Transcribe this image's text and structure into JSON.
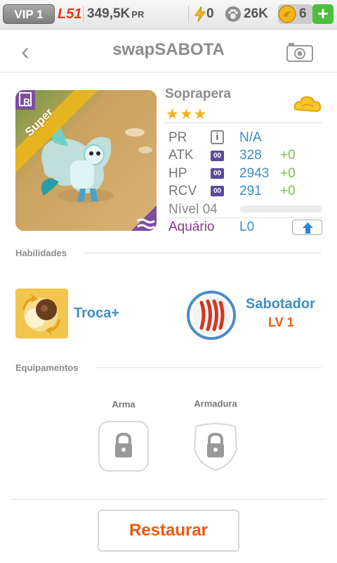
{
  "topbar": {
    "vip": "VIP 1",
    "level": "L51",
    "pr": "349,5K",
    "pr_unit": "PR",
    "energy": "0",
    "paw": "26K",
    "coins": "6",
    "add": "+"
  },
  "header": {
    "back": "‹",
    "title": "swapSABOTA",
    "camera_icon": "camera-icon"
  },
  "monster": {
    "name": "Soprapera",
    "stars": "★★★",
    "tag": "Super",
    "rarity": "R",
    "element_icon": "cloud-icon",
    "pr_label": "PR",
    "pr_value": "N/A",
    "atk_label": "ATK",
    "atk_value": "328",
    "atk_bonus": "+0",
    "hp_label": "HP",
    "hp_value": "2943",
    "hp_bonus": "+0",
    "rcv_label": "RCV",
    "rcv_value": "291",
    "rcv_bonus": "+0",
    "badge": "00",
    "level_label": "Nível 04",
    "level_progress": 0,
    "aquarium_label": "Aquário",
    "aquarium_value": "L0"
  },
  "skills": {
    "section": "Habilidades",
    "skill1": "Troca+",
    "skill2": "Sabotador",
    "skill2_level": "LV 1"
  },
  "equipment": {
    "section": "Equipamentos",
    "weapon": "Arma",
    "armor": "Armadura"
  },
  "restore_button": "Restaurar",
  "colors": {
    "accent": "#3e8fc8",
    "warning": "#ea5a16",
    "aquarium": "#8a3b88",
    "bonus": "#78c24a"
  }
}
